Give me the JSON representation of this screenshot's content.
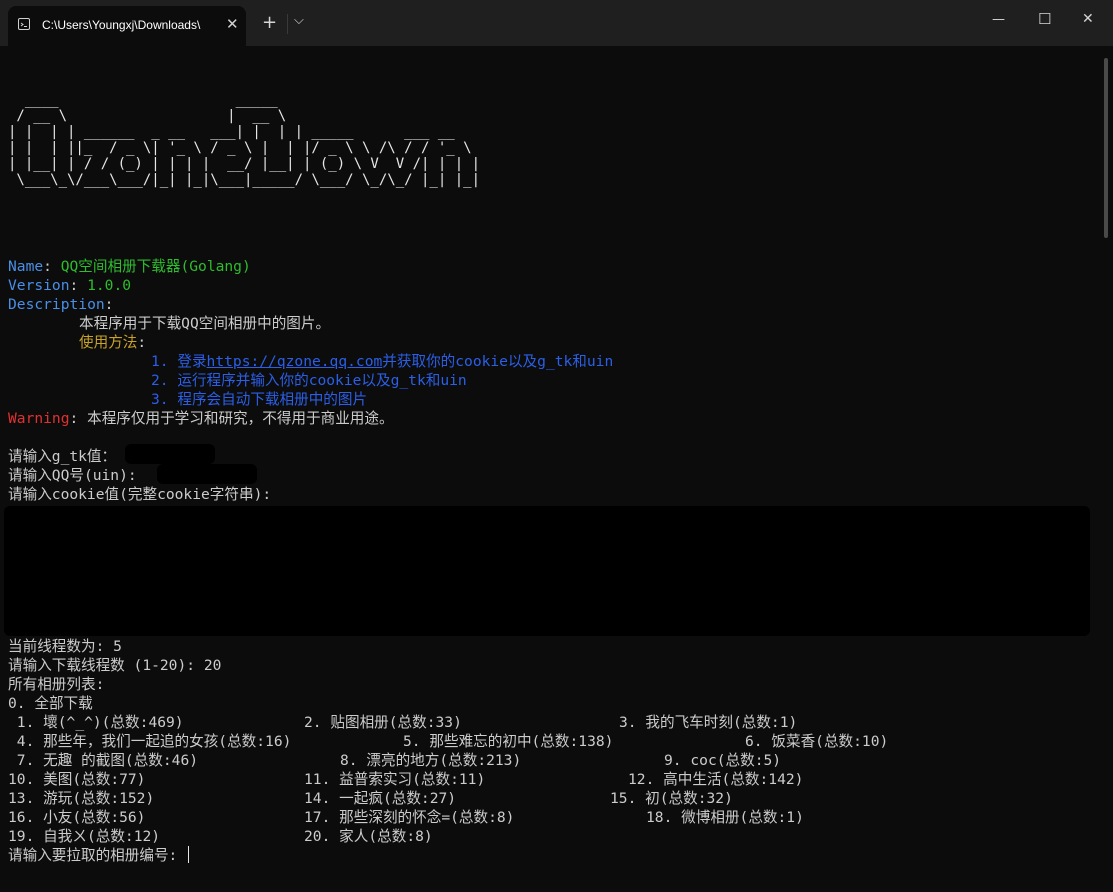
{
  "window": {
    "tab_title": "C:\\Users\\Youngxj\\Downloads\\",
    "tab_icon": "terminal-icon",
    "buttons": {
      "new_tab": "+",
      "dropdown": "⌵",
      "minimize": "—",
      "maximize": "☐",
      "close": "✕"
    }
  },
  "banner": {
    "ascii_art": "  ____                     _____\n / __ \\                   |  __ \\\n| |  | | ______  _ __   ___| |  | | _____      ___ __\n| |  | ||_  / _ \\| '_ \\ / _ \\ |  | |/ _ \\ \\ /\\ / / '_ \\\n| |__| | / / (_) | | | |  __/ |__| | (_) \\ V  V /| | | |\n \\___\\_\\/___\\___/|_| |_|\\___|_____/ \\___/ \\_/\\_/ |_| |_|",
    "name_label": "Name",
    "name_value": "QQ空间相册下载器(Golang)",
    "version_label": "Version",
    "version_value": "1.0.0",
    "description_label": "Description",
    "description_text": "本程序用于下载QQ空间相册中的图片。",
    "usage_label": "使用方法",
    "usage_step1_prefix": "1. 登录",
    "usage_step1_url": "https://qzone.qq.com",
    "usage_step1_suffix": "并获取你的cookie以及g_tk和uin",
    "usage_step2": "2. 运行程序并输入你的cookie以及g_tk和uin",
    "usage_step3": "3. 程序会自动下载相册中的图片",
    "warning_label": "Warning",
    "warning_text": "本程序仅用于学习和研究，不得用于商业用途。"
  },
  "prompts": {
    "gtk": "请输入g_tk值：",
    "uin": "请输入QQ号(uin): ",
    "cookie": "请输入cookie值(完整cookie字符串):",
    "current_threads": "当前线程数为: 5",
    "thread_prompt": "请输入下载线程数 (1-20): 20",
    "album_list_header": "所有相册列表:",
    "download_all": "0. 全部下载",
    "select_prompt": "请输入要拉取的相册编号: "
  },
  "albums": [
    {
      "num": " 1.",
      "name": "壞(^_^)(总数:469)"
    },
    {
      "num": "2.",
      "name": "贴图相册(总数:33)"
    },
    {
      "num": "3.",
      "name": "我的飞车时刻(总数:1)"
    },
    {
      "num": " 4.",
      "name": "那些年，我们一起追的女孩(总数:16)"
    },
    {
      "num": "5.",
      "name": "那些难忘的初中(总数:138)"
    },
    {
      "num": "6.",
      "name": "饭菜香(总数:10)"
    },
    {
      "num": " 7.",
      "name": "无趣 的截图(总数:46)"
    },
    {
      "num": "8.",
      "name": "漂亮的地方(总数:213)"
    },
    {
      "num": "9.",
      "name": "coc(总数:5)"
    },
    {
      "num": "10.",
      "name": "美图(总数:77)"
    },
    {
      "num": "11.",
      "name": "益普索实习(总数:11)"
    },
    {
      "num": "12.",
      "name": "高中生活(总数:142)"
    },
    {
      "num": "13.",
      "name": "游玩(总数:152)"
    },
    {
      "num": "14.",
      "name": "一起疯(总数:27)"
    },
    {
      "num": "15.",
      "name": "初(总数:32)"
    },
    {
      "num": "16.",
      "name": "小友(总数:56)"
    },
    {
      "num": "17.",
      "name": "那些深刻的怀念=(总数:8)"
    },
    {
      "num": "18.",
      "name": "微博相册(总数:1)"
    },
    {
      "num": "19.",
      "name": "自我ㄨ(总数:12)"
    },
    {
      "num": "20.",
      "name": "家人(总数:8)"
    }
  ],
  "colors": {
    "background": "#0c0c0c",
    "label_blue": "#4a8ee6",
    "value_green": "#2dbd2d",
    "usage_yellow": "#c9a228",
    "step_blue": "#2b5fe8",
    "warning_red": "#e03131"
  }
}
